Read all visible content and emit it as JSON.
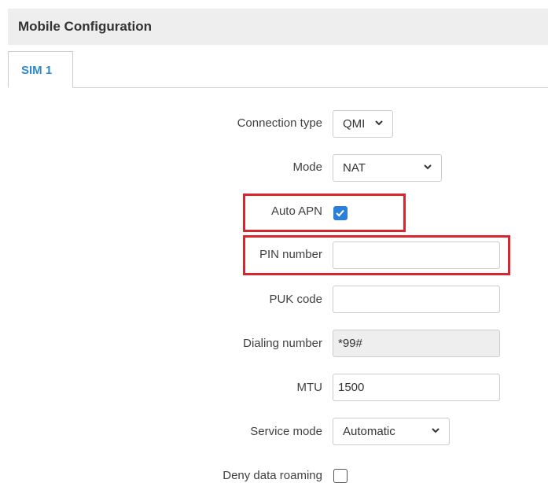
{
  "section": {
    "title": "Mobile Configuration"
  },
  "tabs": [
    {
      "label": "SIM 1",
      "active": true
    }
  ],
  "form": {
    "connection_type": {
      "label": "Connection type",
      "value": "QMI"
    },
    "mode": {
      "label": "Mode",
      "value": "NAT"
    },
    "auto_apn": {
      "label": "Auto APN",
      "checked": true
    },
    "pin_number": {
      "label": "PIN number",
      "value": ""
    },
    "puk_code": {
      "label": "PUK code",
      "value": ""
    },
    "dialing_number": {
      "label": "Dialing number",
      "value": "*99#",
      "readonly": true
    },
    "mtu": {
      "label": "MTU",
      "value": "1500"
    },
    "service_mode": {
      "label": "Service mode",
      "value": "Automatic"
    },
    "deny_data_roaming": {
      "label": "Deny data roaming",
      "checked": false
    }
  },
  "highlight_color": "#d9262e",
  "accent_color": "#2f88c9"
}
